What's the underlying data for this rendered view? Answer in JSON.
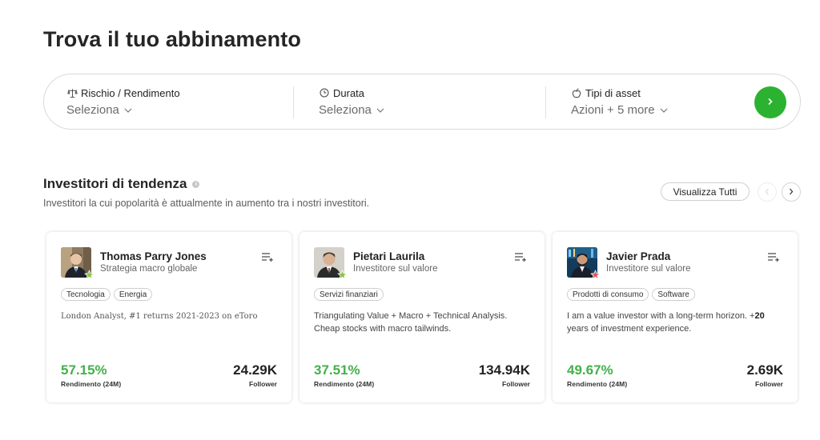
{
  "page": {
    "title": "Trova il tuo abbinamento"
  },
  "filters": [
    {
      "label": "Rischio / Rendimento",
      "value": "Seleziona",
      "icon": "balance-scale-icon"
    },
    {
      "label": "Durata",
      "value": "Seleziona",
      "icon": "clock-icon"
    },
    {
      "label": "Tipi di asset",
      "value": "Azioni + 5 more",
      "icon": "apple-icon"
    }
  ],
  "go_button": {
    "icon": "chevron-right-icon",
    "color": "#2bb231"
  },
  "trending": {
    "title": "Investitori di tendenza",
    "subtitle": "Investitori la cui popolarità è attualmente in aumento tra i nostri investitori.",
    "view_all": "Visualizza Tutti"
  },
  "colors": {
    "positive": "#43b04a",
    "accent": "#2bb231",
    "star_green": "#8bc34a",
    "star_red": "#e05a5a"
  },
  "cards": [
    {
      "name": "Thomas Parry Jones",
      "strategy": "Strategia macro globale",
      "tags": [
        "Tecnologia",
        "Energia"
      ],
      "bio": "London Analyst, #1 returns 2021-2023 on eToro",
      "return_value": "57.15%",
      "return_label": "Rendimento (24M)",
      "followers_value": "24.29K",
      "followers_label": "Follower",
      "badge": "green-star-icon"
    },
    {
      "name": "Pietari Laurila",
      "strategy": "Investitore sul valore",
      "tags": [
        "Servizi finanziari"
      ],
      "bio": "Triangulating Value + Macro + Technical Analysis. Cheap stocks with macro tailwinds.",
      "return_value": "37.51%",
      "return_label": "Rendimento (24M)",
      "followers_value": "134.94K",
      "followers_label": "Follower",
      "badge": "green-star-icon"
    },
    {
      "name": "Javier Prada",
      "strategy": "Investitore sul valore",
      "tags": [
        "Prodotti di consumo",
        "Software"
      ],
      "bio_start": "I am a value investor with a long-term horizon. +",
      "bio_bold": "20",
      "bio_end": " years of investment experience.",
      "return_value": "49.67%",
      "return_label": "Rendimento (24M)",
      "followers_value": "2.69K",
      "followers_label": "Follower",
      "badge": "red-star-icon"
    }
  ]
}
